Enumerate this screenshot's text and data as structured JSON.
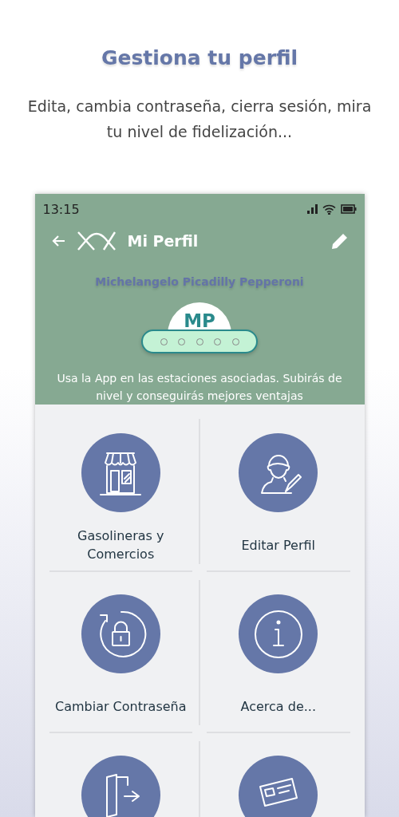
{
  "headline": "Gestiona tu perfil",
  "subtitle": "Edita, cambia contraseña, cierra sesión, mira tu nivel de fidelización...",
  "status_bar": {
    "time": "13:15"
  },
  "app_bar": {
    "title": "Mi Perfil"
  },
  "profile": {
    "name": "Michelangelo Picadilly Pepperoni",
    "initials": "MP",
    "message": "Usa la App en las estaciones asociadas. Subirás de nivel y conseguirás mejores ventajas"
  },
  "menu": [
    {
      "kind": "store",
      "label": "Gasolineras y Comercios"
    },
    {
      "kind": "user-edit",
      "label": "Editar Perfil"
    },
    {
      "kind": "lock",
      "label": "Cambiar Contraseña"
    },
    {
      "kind": "info",
      "label": "Acerca de..."
    },
    {
      "kind": "door"
    },
    {
      "kind": "card"
    }
  ]
}
